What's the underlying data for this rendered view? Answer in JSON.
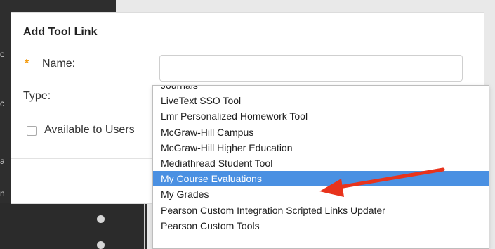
{
  "modal": {
    "title": "Add Tool Link",
    "name_label": "Name:",
    "name_value": "",
    "required_marker": "*",
    "type_label": "Type:",
    "available_label": "Available to Users",
    "available_checked": false
  },
  "type_dropdown": {
    "options": [
      "Journals",
      "LiveText SSO Tool",
      "Lmr Personalized Homework Tool",
      "McGraw-Hill Campus",
      "McGraw-Hill Higher Education",
      "Mediathread Student Tool",
      "My Course Evaluations",
      "My Grades",
      "Pearson Custom Integration Scripted Links Updater",
      "Pearson Custom Tools"
    ],
    "selected": "My Course Evaluations"
  },
  "colors": {
    "selection": "#4a90e2",
    "annotation_arrow": "#e8331c",
    "required_marker": "#f39c12"
  }
}
